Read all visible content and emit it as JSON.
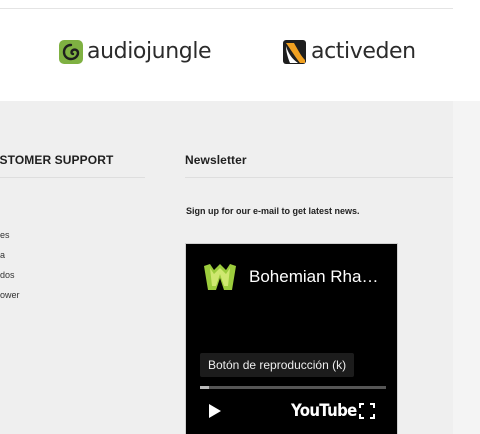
{
  "partners": {
    "audiojungle": {
      "name": "audiojungle",
      "icon": "audiojungle-logo-icon",
      "accent": "#7fb142"
    },
    "activeden": {
      "name": "activeden",
      "icon": "activeden-logo-icon",
      "accent": "#f0a020"
    }
  },
  "footer": {
    "support": {
      "heading": "CUSTOMER SUPPORT",
      "items": [
        "es",
        "a",
        "dos",
        "ower"
      ]
    },
    "newsletter": {
      "heading": "Newsletter",
      "text": "Sign up for our e-mail to get latest news."
    },
    "video": {
      "title": "Bohemian Rha…",
      "channel_icon": "channel-avatar-icon",
      "tooltip": "Botón de reproducción (k)",
      "progress": 0.05,
      "platform": "YouTube",
      "play_icon": "play-icon",
      "fullscreen_icon": "fullscreen-icon"
    }
  },
  "colors": {
    "footer_bg": "#efefef",
    "video_bg": "#000000"
  }
}
